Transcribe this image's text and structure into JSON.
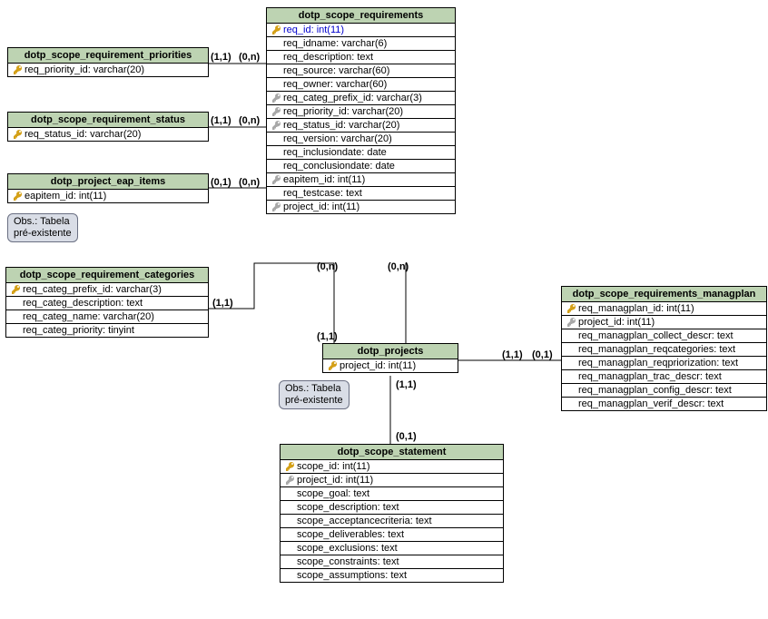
{
  "entities": {
    "priorities": {
      "title": "dotp_scope_requirement_priorities",
      "fields": [
        {
          "text": "req_priority_id: varchar(20)",
          "key": "pk"
        }
      ]
    },
    "status": {
      "title": "dotp_scope_requirement_status",
      "fields": [
        {
          "text": "req_status_id: varchar(20)",
          "key": "pk"
        }
      ]
    },
    "eap": {
      "title": "dotp_project_eap_items",
      "fields": [
        {
          "text": "eapitem_id: int(11)",
          "key": "pk"
        }
      ]
    },
    "categories": {
      "title": "dotp_scope_requirement_categories",
      "fields": [
        {
          "text": "req_categ_prefix_id: varchar(3)",
          "key": "pk"
        },
        {
          "text": "req_categ_description: text",
          "key": null
        },
        {
          "text": "req_categ_name: varchar(20)",
          "key": null
        },
        {
          "text": "req_categ_priority: tinyint",
          "key": null
        }
      ]
    },
    "requirements": {
      "title": "dotp_scope_requirements",
      "fields": [
        {
          "text": "req_id: int(11)",
          "key": "pk",
          "blue": true
        },
        {
          "text": "req_idname: varchar(6)",
          "key": null
        },
        {
          "text": "req_description: text",
          "key": null
        },
        {
          "text": "req_source: varchar(60)",
          "key": null
        },
        {
          "text": "req_owner: varchar(60)",
          "key": null
        },
        {
          "text": "req_categ_prefix_id: varchar(3)",
          "key": "fk"
        },
        {
          "text": "req_priority_id: varchar(20)",
          "key": "fk"
        },
        {
          "text": "req_status_id: varchar(20)",
          "key": "fk"
        },
        {
          "text": "req_version: varchar(20)",
          "key": null
        },
        {
          "text": "req_inclusiondate: date",
          "key": null
        },
        {
          "text": "req_conclusiondate: date",
          "key": null
        },
        {
          "text": "eapitem_id: int(11)",
          "key": "fk"
        },
        {
          "text": "req_testcase: text",
          "key": null
        },
        {
          "text": "project_id: int(11)",
          "key": "fk"
        }
      ]
    },
    "projects": {
      "title": "dotp_projects",
      "fields": [
        {
          "text": "project_id: int(11)",
          "key": "pk"
        }
      ]
    },
    "statement": {
      "title": "dotp_scope_statement",
      "fields": [
        {
          "text": "scope_id: int(11)",
          "key": "pk"
        },
        {
          "text": "project_id: int(11)",
          "key": "fk"
        },
        {
          "text": "scope_goal: text",
          "key": null
        },
        {
          "text": "scope_description: text",
          "key": null
        },
        {
          "text": "scope_acceptancecriteria: text",
          "key": null
        },
        {
          "text": "scope_deliverables: text",
          "key": null
        },
        {
          "text": "scope_exclusions: text",
          "key": null
        },
        {
          "text": "scope_constraints: text",
          "key": null
        },
        {
          "text": "scope_assumptions: text",
          "key": null
        }
      ]
    },
    "managplan": {
      "title": "dotp_scope_requirements_managplan",
      "fields": [
        {
          "text": "req_managplan_id: int(11)",
          "key": "pk"
        },
        {
          "text": "project_id: int(11)",
          "key": "fk"
        },
        {
          "text": "req_managplan_collect_descr: text",
          "key": null
        },
        {
          "text": "req_managplan_reqcategories: text",
          "key": null
        },
        {
          "text": "req_managplan_reqpriorization: text",
          "key": null
        },
        {
          "text": "req_managplan_trac_descr: text",
          "key": null
        },
        {
          "text": "req_managplan_config_descr: text",
          "key": null
        },
        {
          "text": "req_managplan_verif_descr: text",
          "key": null
        }
      ]
    }
  },
  "notes": {
    "eap": "Obs.: Tabela\npré-existente",
    "projects": "Obs.: Tabela\npré-existente"
  },
  "cardinalities": {
    "pri_l": "(1,1)",
    "pri_r": "(0,n)",
    "sta_l": "(1,1)",
    "sta_r": "(0,n)",
    "eap_l": "(0,1)",
    "eap_r": "(0,n)",
    "cat_l": "(1,1)",
    "req_dl": "(0,n)",
    "req_dr": "(0,n)",
    "proj_up": "(1,1)",
    "proj_dn": "(1,1)",
    "mp_l1": "(1,1)",
    "mp_l2": "(0,1)",
    "stmt_up": "(0,1)"
  }
}
